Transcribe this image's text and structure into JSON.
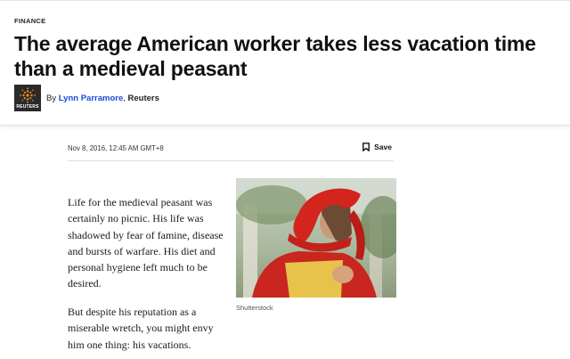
{
  "article": {
    "category": "FINANCE",
    "headline": "The average American worker takes less vacation time than a medieval peasant",
    "byline": {
      "prefix": "By",
      "author": "Lynn Parramore",
      "separator": ",",
      "outlet": "Reuters",
      "logo_text": "REUTERS"
    },
    "date": "Nov 8, 2016, 12:45 AM GMT+8",
    "save_label": "Save",
    "body": {
      "p1": "Life for the medieval peasant was certainly no picnic. His life was shadowed by fear of famine, disease and bursts of warfare. His diet and personal hygiene left much to be desired.",
      "p2": "But despite his reputation as a miserable wretch, you might envy him one thing: his vacations."
    },
    "image_caption": "Shutterstock"
  },
  "icons": {
    "logo": "reuters-logo-icon",
    "save": "bookmark-icon"
  },
  "colors": {
    "author_link": "#1a4bd4",
    "logo_bg": "#2a2a2a",
    "logo_accent": "#f08a1c"
  }
}
